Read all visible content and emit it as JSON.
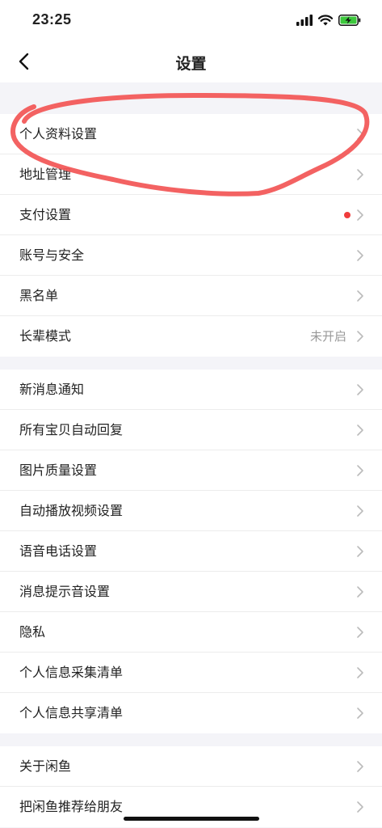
{
  "status_bar": {
    "time": "23:25"
  },
  "header": {
    "title": "设置"
  },
  "groups": [
    {
      "items": [
        {
          "label": "个人资料设置",
          "value": ""
        },
        {
          "label": "地址管理",
          "value": ""
        },
        {
          "label": "支付设置",
          "value": "",
          "badge": "red-dot"
        },
        {
          "label": "账号与安全",
          "value": ""
        },
        {
          "label": "黑名单",
          "value": ""
        },
        {
          "label": "长辈模式",
          "value": "未开启"
        }
      ]
    },
    {
      "items": [
        {
          "label": "新消息通知"
        },
        {
          "label": "所有宝贝自动回复"
        },
        {
          "label": "图片质量设置"
        },
        {
          "label": "自动播放视频设置"
        },
        {
          "label": "语音电话设置"
        },
        {
          "label": "消息提示音设置"
        },
        {
          "label": "隐私"
        },
        {
          "label": "个人信息采集清单"
        },
        {
          "label": "个人信息共享清单"
        }
      ]
    },
    {
      "items": [
        {
          "label": "关于闲鱼"
        },
        {
          "label": "把闲鱼推荐给朋友"
        }
      ]
    }
  ],
  "colors": {
    "annotation": "#f25a5a",
    "badge": "#f03c3c",
    "battery": "#3cc83c"
  }
}
